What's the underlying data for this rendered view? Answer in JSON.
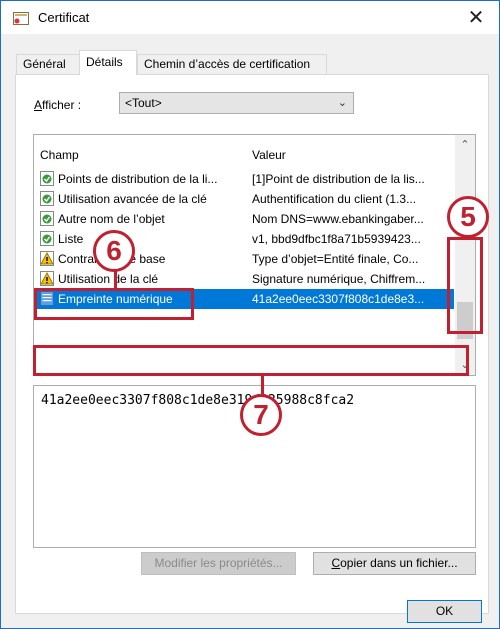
{
  "window": {
    "title": "Certificat",
    "close_glyph": "✕"
  },
  "tabs": [
    {
      "label": "Général",
      "active": false
    },
    {
      "label": "Détails",
      "active": true
    },
    {
      "label": "Chemin d’accès de certification",
      "active": false
    }
  ],
  "filter": {
    "label_underlined": "A",
    "label_rest": "fficher :",
    "selected": "<Tout>"
  },
  "list": {
    "columns": [
      "Champ",
      "Valeur"
    ],
    "rows": [
      {
        "field": "Points de distribution de la li...",
        "value": "[1]Point de distribution de la lis...",
        "icon": "cert-field-icon",
        "selected": false
      },
      {
        "field": "Utilisation avancée de la clé",
        "value": "Authentification du client (1.3...",
        "icon": "cert-field-icon",
        "selected": false
      },
      {
        "field": "Autre nom de l’objet",
        "value": "Nom DNS=www.ebankingaber...",
        "icon": "cert-field-icon",
        "selected": false
      },
      {
        "field": "Liste",
        "value": "v1, bbd9dfbc1f8a71b5939423...",
        "icon": "cert-field-icon",
        "selected": false
      },
      {
        "field": "Contraintes de base",
        "value": "Type d’objet=Entité finale, Co...",
        "icon": "warning-cert-icon",
        "selected": false
      },
      {
        "field": "Utilisation de la clé",
        "value": "Signature numérique, Chiffrem...",
        "icon": "warning-cert-icon",
        "selected": false
      },
      {
        "field": "Empreinte numérique",
        "value": "41a2ee0eec3307f808c1de8e3...",
        "icon": "thumbprint-icon",
        "selected": true
      }
    ]
  },
  "value_box": {
    "text": "41a2ee0eec3307f808c1de8e319d925988c8fca2"
  },
  "buttons": {
    "edit_props": "Modifier les propriétés...",
    "copy_underlined": "C",
    "copy_rest": "opier dans un fichier...",
    "ok": "OK"
  },
  "annotations": {
    "five": "5",
    "six": "6",
    "seven": "7",
    "color": "#c0202f"
  },
  "colors": {
    "selection": "#0078d7",
    "accent_border": "#1c6fc7"
  }
}
